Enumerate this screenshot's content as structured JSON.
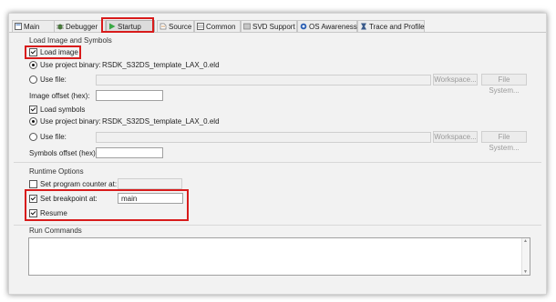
{
  "tabs": [
    {
      "label": "Main",
      "icon": "main-tab-icon"
    },
    {
      "label": "Debugger",
      "icon": "debugger-bug-icon"
    },
    {
      "label": "Startup",
      "icon": "startup-play-icon"
    },
    {
      "label": "Source",
      "icon": "source-icon"
    },
    {
      "label": "Common",
      "icon": "common-icon"
    },
    {
      "label": "SVD Support",
      "icon": "svd-icon"
    },
    {
      "label": "OS Awareness",
      "icon": "os-awareness-icon"
    },
    {
      "label": "Trace and Profile",
      "icon": "trace-icon"
    }
  ],
  "active_tab": "Startup",
  "load_group": {
    "title": "Load Image and Symbols",
    "load_image_label": "Load image",
    "load_image_checked": true,
    "use_project_binary_label": "Use project binary:",
    "image_binary": "RSDK_S32DS_template_LAX_0.eld",
    "use_file_label": "Use file:",
    "workspace_label": "Workspace...",
    "filesystem_label": "File System...",
    "image_offset_label": "Image offset (hex):",
    "image_offset_value": "",
    "load_symbols_label": "Load symbols",
    "load_symbols_checked": true,
    "symbols_binary": "RSDK_S32DS_template_LAX_0.eld",
    "symbols_offset_label": "Symbols offset (hex):",
    "symbols_offset_value": ""
  },
  "runtime_group": {
    "title": "Runtime Options",
    "set_pc_label": "Set program counter at:",
    "set_pc_checked": false,
    "set_bp_label": "Set breakpoint at:",
    "set_bp_checked": true,
    "breakpoint_value": "main",
    "resume_label": "Resume",
    "resume_checked": true
  },
  "run_commands": {
    "title": "Run Commands",
    "value": ""
  },
  "colors": {
    "highlight": "#d81b1b"
  }
}
